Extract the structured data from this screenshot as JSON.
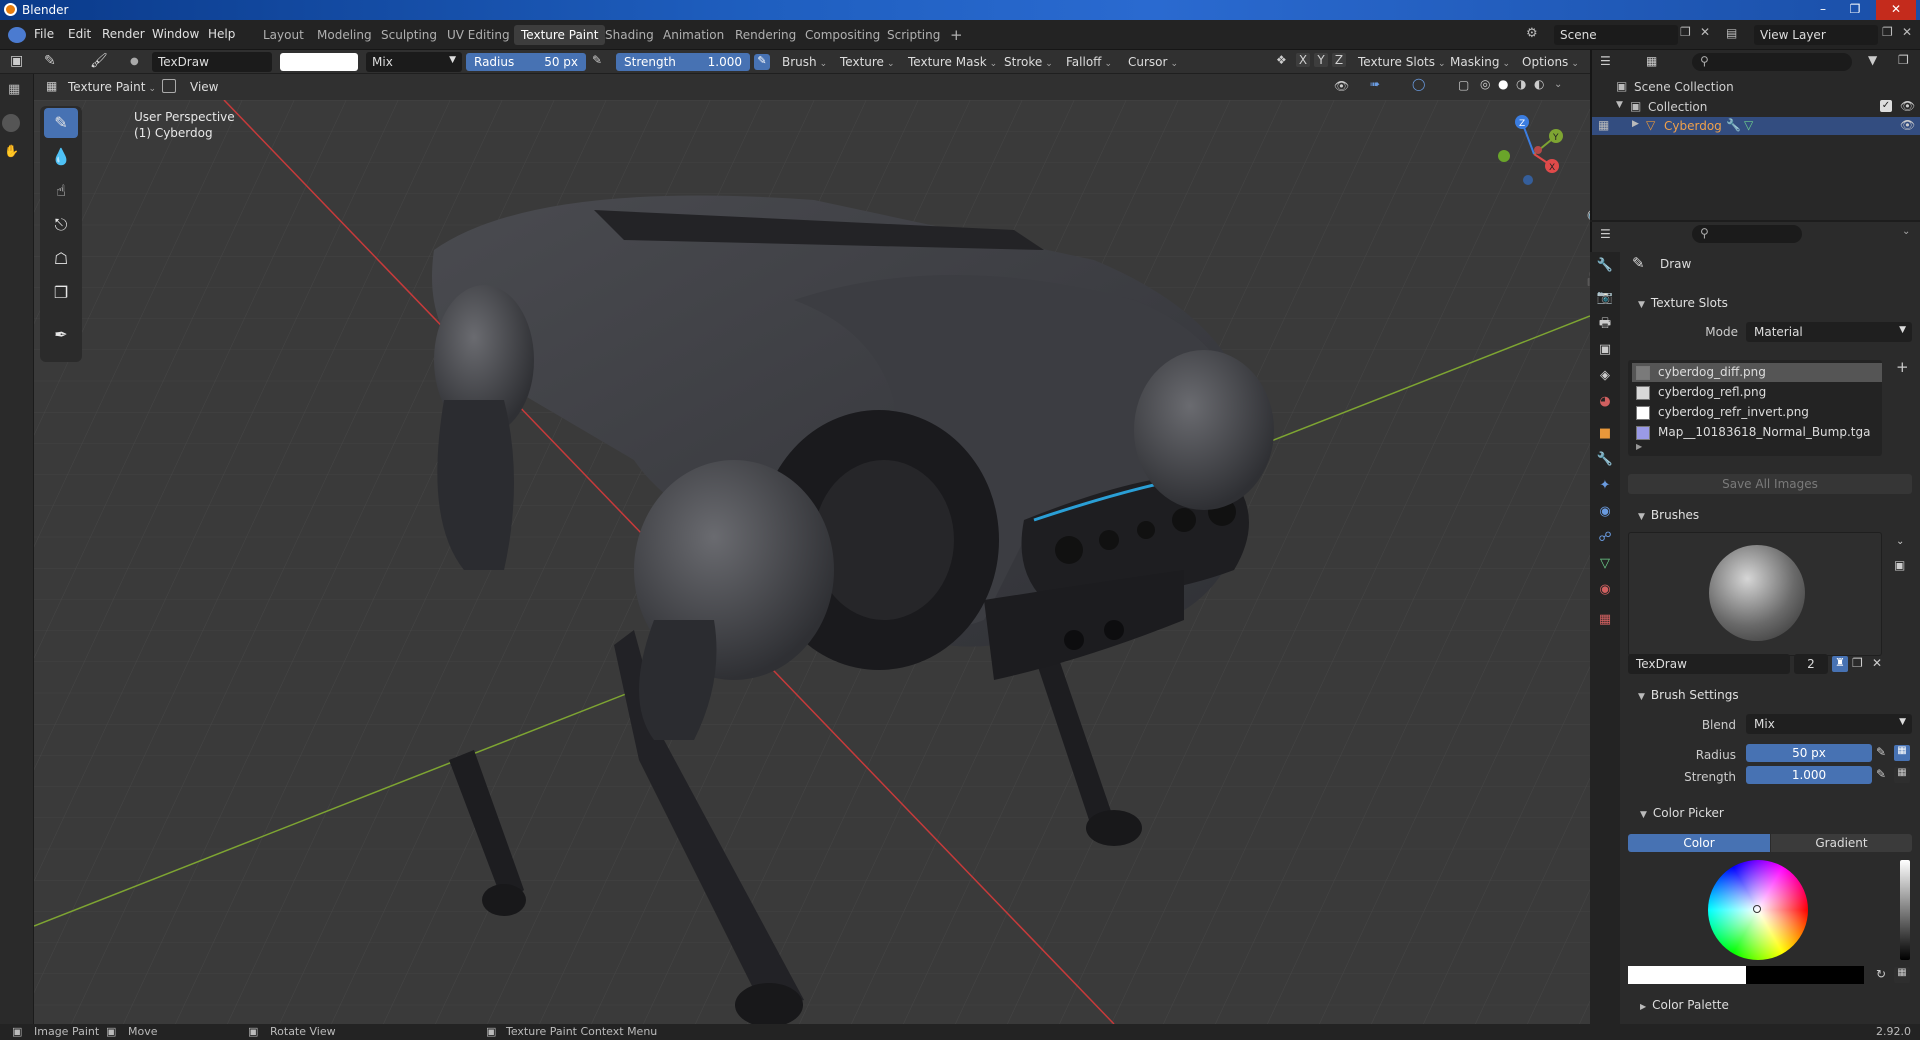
{
  "titlebar": {
    "title": "Blender"
  },
  "menus": [
    "File",
    "Edit",
    "Render",
    "Window",
    "Help"
  ],
  "workspaces": [
    "Layout",
    "Modeling",
    "Sculpting",
    "UV Editing",
    "Texture Paint",
    "Shading",
    "Animation",
    "Rendering",
    "Compositing",
    "Scripting"
  ],
  "active_workspace": "Texture Paint",
  "scene": {
    "name": "Scene",
    "view_layer": "View Layer"
  },
  "tool_header": {
    "brush_name": "TexDraw",
    "blend": "Mix",
    "radius_label": "Radius",
    "radius_value": "50 px",
    "strength_label": "Strength",
    "strength_value": "1.000",
    "menus": [
      "Brush",
      "Texture",
      "Texture Mask",
      "Stroke",
      "Falloff",
      "Cursor"
    ],
    "axes": [
      "X",
      "Y",
      "Z"
    ],
    "right_menus": [
      "Texture Slots",
      "Masking",
      "Options"
    ]
  },
  "viewport_header": {
    "mode": "Texture Paint",
    "view_menu": "View"
  },
  "viewport": {
    "perspective": "User Perspective",
    "object": "(1) Cyberdog"
  },
  "gizmo": {
    "x": "X",
    "y": "Y",
    "z": "Z"
  },
  "outliner": {
    "root": "Scene Collection",
    "collection": "Collection",
    "object": "Cyberdog"
  },
  "properties": {
    "tool_name": "Draw",
    "texture_slots": {
      "title": "Texture Slots",
      "mode_label": "Mode",
      "mode_value": "Material",
      "slots": [
        {
          "name": "cyberdog_diff.png",
          "color": "#7a7a7a"
        },
        {
          "name": "cyberdog_refl.png",
          "color": "#d8d8d8"
        },
        {
          "name": "cyberdog_refr_invert.png",
          "color": "#ffffff"
        },
        {
          "name": "Map__10183618_Normal_Bump.tga",
          "color": "#9a9ae6"
        }
      ],
      "save_all": "Save All Images"
    },
    "brushes": {
      "title": "Brushes",
      "brush_name": "TexDraw",
      "users": "2"
    },
    "brush_settings": {
      "title": "Brush Settings",
      "blend_label": "Blend",
      "blend_value": "Mix",
      "radius_label": "Radius",
      "radius_value": "50 px",
      "strength_label": "Strength",
      "strength_value": "1.000"
    },
    "color_picker": {
      "title": "Color Picker",
      "tab_color": "Color",
      "tab_gradient": "Gradient"
    },
    "color_palette": {
      "title": "Color Palette"
    }
  },
  "statusbar": {
    "left": "Image Paint",
    "move": "Move",
    "rotate": "Rotate View",
    "context": "Texture Paint Context Menu",
    "version": "2.92.0"
  },
  "colors": {
    "accent": "#4772b3",
    "x_axis": "#c73a3a",
    "y_axis": "#7ea532",
    "viewport": "#3a3a3a"
  }
}
